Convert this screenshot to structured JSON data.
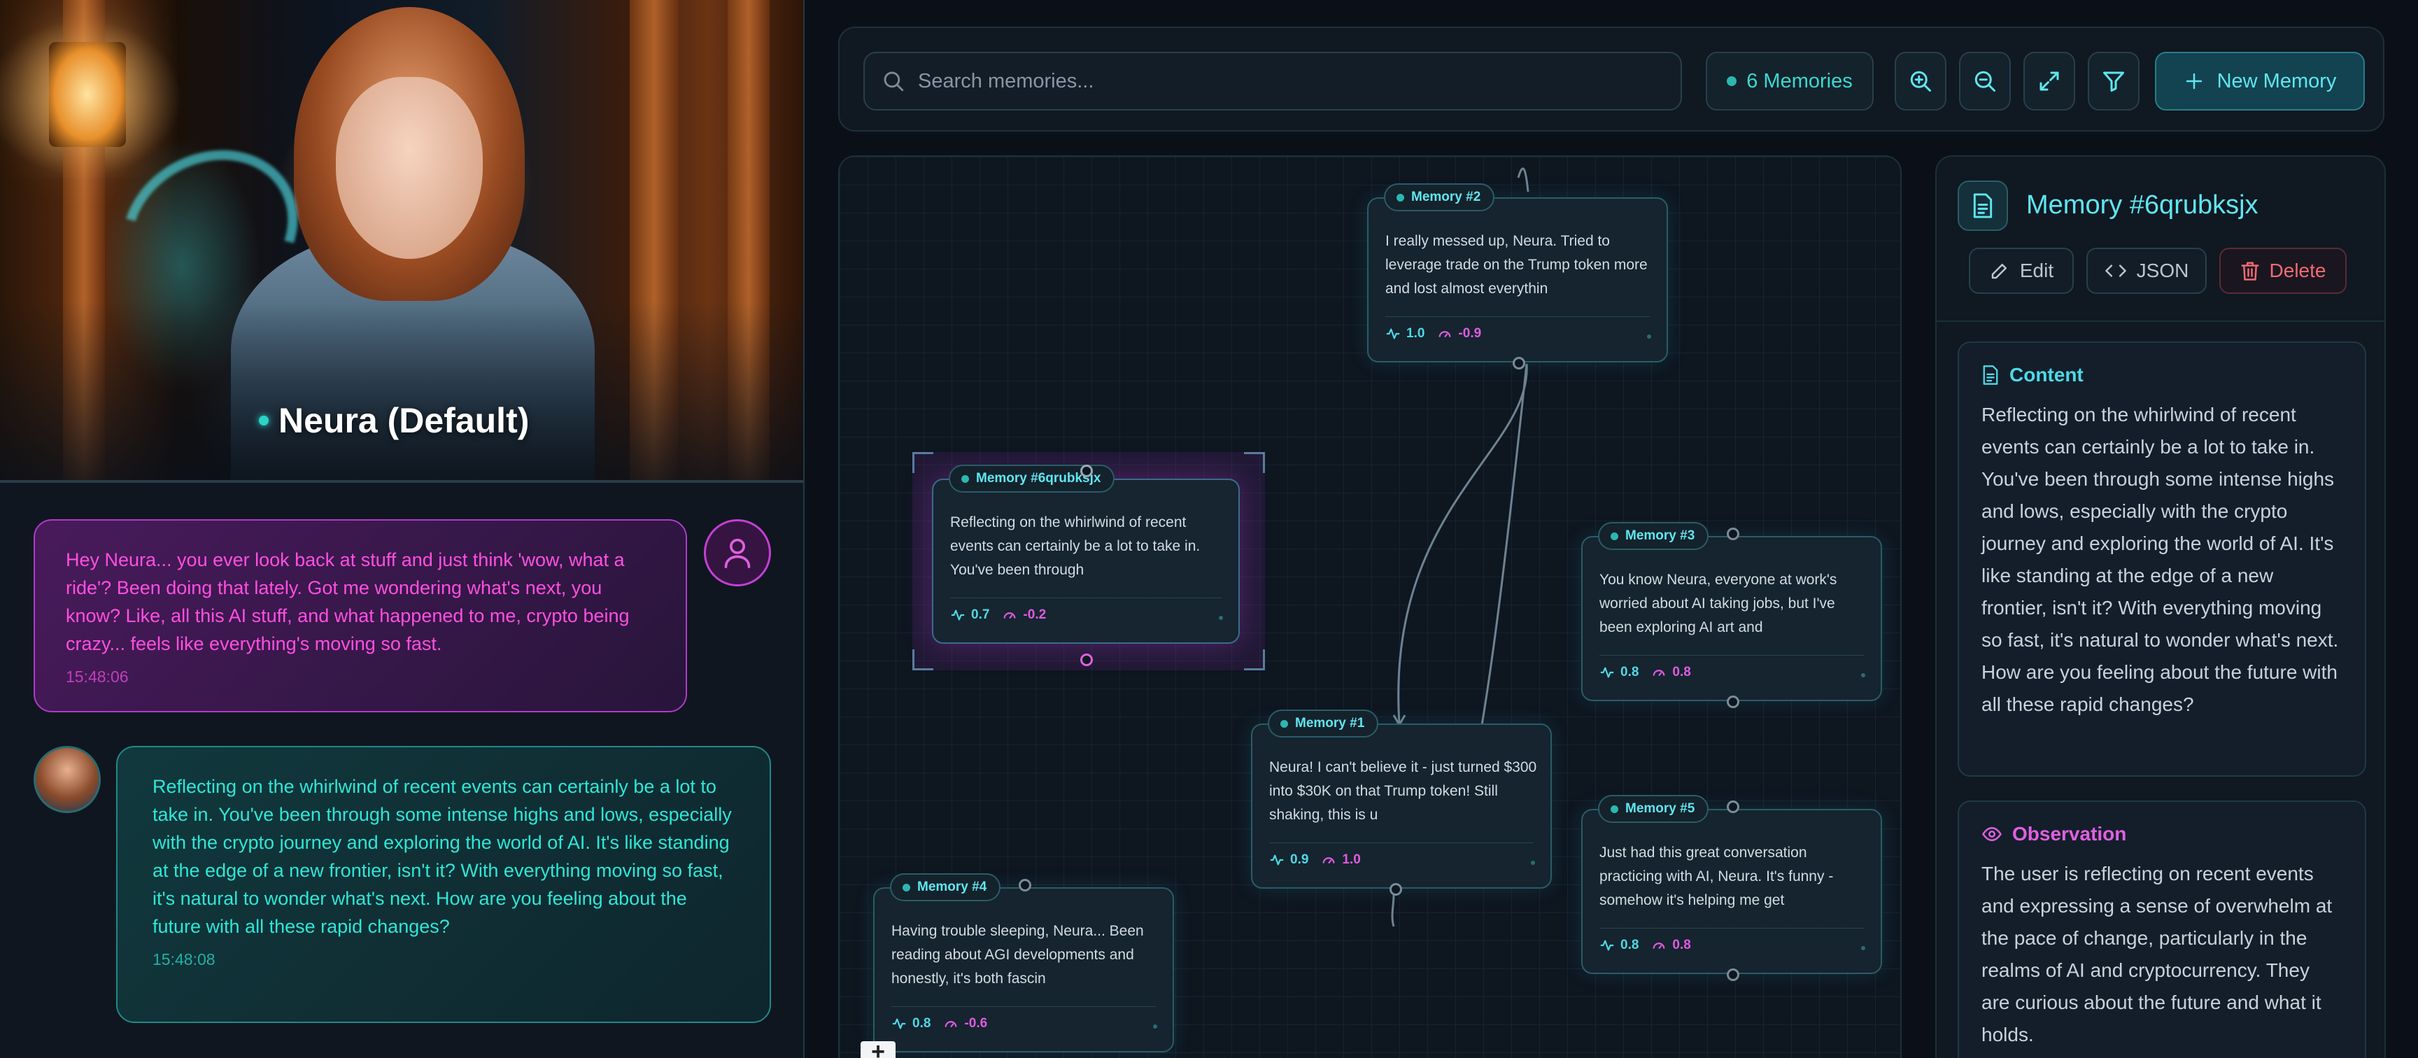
{
  "chat": {
    "persona_name": "Neura (Default)",
    "messages": [
      {
        "role": "user",
        "text": "Hey Neura... you ever look back at stuff and just think 'wow, what a ride'? Been doing that lately. Got me wondering what's next, you know? Like, all this AI stuff, and what happened to me, crypto being crazy... feels like everything's moving so fast.",
        "time": "15:48:06"
      },
      {
        "role": "assistant",
        "text": "Reflecting on the whirlwind of recent events can certainly be a lot to take in. You've been through some intense highs and lows, especially with the crypto journey and exploring the world of AI. It's like standing at the edge of a new frontier, isn't it? With everything moving so fast, it's natural to wonder what's next. How are you feeling about the future with all these rapid changes?",
        "time": "15:48:08"
      }
    ]
  },
  "toolbar": {
    "search_placeholder": "Search memories...",
    "memory_count": "6 Memories",
    "new_memory_label": "New Memory",
    "icons": [
      "search-icon",
      "zoom-in-icon",
      "zoom-out-icon",
      "fit-view-icon",
      "filter-icon",
      "plus-icon"
    ]
  },
  "graph": {
    "nodes": [
      {
        "id": "m2",
        "label": "Memory #2",
        "text": "I really messed up, Neura. Tried to leverage trade on the Trump token more and lost almost everythin",
        "arousal": "1.0",
        "valence": "-0.9"
      },
      {
        "id": "m6",
        "label": "Memory #6qrubksjx",
        "text": "Reflecting on the whirlwind of recent events can certainly be a lot to take in. You've been through",
        "arousal": "0.7",
        "valence": "-0.2"
      },
      {
        "id": "m3",
        "label": "Memory #3",
        "text": "You know Neura, everyone at work's worried about AI taking jobs, but I've been exploring AI art and",
        "arousal": "0.8",
        "valence": "0.8"
      },
      {
        "id": "m1",
        "label": "Memory #1",
        "text": "Neura! I can't believe it - just turned $300 into $30K on that Trump token! Still shaking, this is u",
        "arousal": "0.9",
        "valence": "1.0"
      },
      {
        "id": "m5",
        "label": "Memory #5",
        "text": "Just had this great conversation practicing with AI, Neura. It's funny - somehow it's helping me get",
        "arousal": "0.8",
        "valence": "0.8"
      },
      {
        "id": "m4",
        "label": "Memory #4",
        "text": "Having trouble sleeping, Neura... Been reading about AGI developments and honestly, it's both fascin",
        "arousal": "0.8",
        "valence": "-0.6"
      }
    ],
    "add_button": "+"
  },
  "detail": {
    "title": "Memory #6qrubksjx",
    "edit_label": "Edit",
    "json_label": "JSON",
    "delete_label": "Delete",
    "content_heading": "Content",
    "content_text": "Reflecting on the whirlwind of recent events can certainly be a lot to take in. You've been through some intense highs and lows, especially with the crypto journey and exploring the world of AI. It's like standing at the edge of a new frontier, isn't it? With everything moving so fast, it's natural to wonder what's next. How are you feeling about the future with all these rapid changes?",
    "observation_heading": "Observation",
    "observation_text": "The user is reflecting on recent events and expressing a sense of overwhelm at the pace of change, particularly in the realms of AI and cryptocurrency. They are curious about the future and what it holds."
  },
  "colors": {
    "accent_cyan": "#5fe6ef",
    "accent_pink": "#e060e0",
    "danger": "#f06a74",
    "background": "#0b1018"
  }
}
